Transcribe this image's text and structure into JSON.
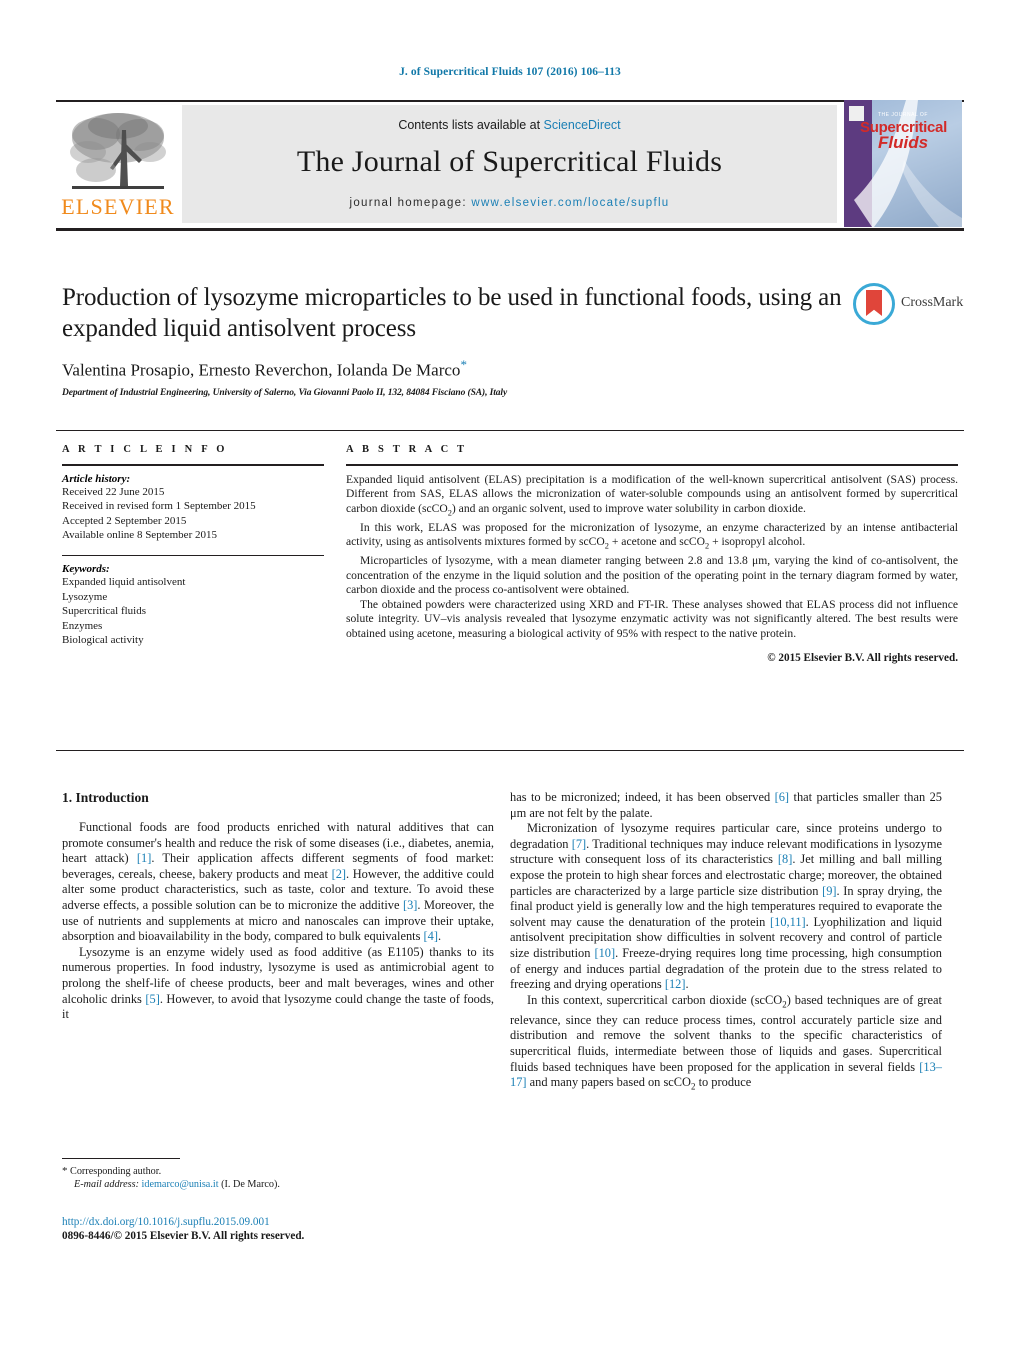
{
  "running_head": "J. of Supercritical Fluids 107 (2016) 106–113",
  "masthead": {
    "contents_prefix": "Contents lists available at ",
    "sciencedirect": "ScienceDirect",
    "journal_title": "The Journal of Supercritical Fluids",
    "homepage_prefix": "journal homepage: ",
    "homepage_url": "www.elsevier.com/locate/supflu",
    "publisher_logo": "ELSEVIER",
    "cover": {
      "line1": "THE JOURNAL OF",
      "line2": "Supercritical",
      "line3": "Fluids"
    }
  },
  "article": {
    "title": "Production of lysozyme microparticles to be used in functional foods, using an expanded liquid antisolvent process",
    "authors": "Valentina Prosapio, Ernesto Reverchon, Iolanda De Marco",
    "corresponding_marker": "*",
    "affiliation": "Department of Industrial Engineering, University of Salerno, Via Giovanni Paolo II, 132, 84084 Fisciano (SA), Italy",
    "crossmark_label": "CrossMark"
  },
  "article_info": {
    "heading": "A R T I C L E   I N F O",
    "history_label": "Article history:",
    "history": [
      "Received 22 June 2015",
      "Received in revised form 1 September 2015",
      "Accepted 2 September 2015",
      "Available online 8 September 2015"
    ],
    "keywords_label": "Keywords:",
    "keywords": [
      "Expanded liquid antisolvent",
      "Lysozyme",
      "Supercritical fluids",
      "Enzymes",
      "Biological activity"
    ]
  },
  "abstract": {
    "heading": "A B S T R A C T",
    "paragraphs": [
      "Expanded liquid antisolvent (ELAS) precipitation is a modification of the well-known supercritical antisolvent (SAS) process. Different from SAS, ELAS allows the micronization of water-soluble compounds using an antisolvent formed by supercritical carbon dioxide (scCO₂) and an organic solvent, used to improve water solubility in carbon dioxide.",
      "In this work, ELAS was proposed for the micronization of lysozyme, an enzyme characterized by an intense antibacterial activity, using as antisolvents mixtures formed by scCO₂ + acetone and scCO₂ + isopropyl alcohol.",
      "Microparticles of lysozyme, with a mean diameter ranging between 2.8 and 13.8 μm, varying the kind of co-antisolvent, the concentration of the enzyme in the liquid solution and the position of the operating point in the ternary diagram formed by water, carbon dioxide and the process co-antisolvent were obtained.",
      "The obtained powders were characterized using XRD and FT-IR. These analyses showed that ELAS process did not influence solute integrity. UV–vis analysis revealed that lysozyme enzymatic activity was not significantly altered. The best results were obtained using acetone, measuring a biological activity of 95% with respect to the native protein."
    ],
    "copyright": "© 2015 Elsevier B.V. All rights reserved."
  },
  "body": {
    "section_number_title": "1.  Introduction",
    "left_column": [
      "Functional foods are food products enriched with natural additives that can promote consumer's health and reduce the risk of some diseases (i.e., diabetes, anemia, heart attack) [1]. Their application affects different segments of food market: beverages, cereals, cheese, bakery products and meat [2]. However, the additive could alter some product characteristics, such as taste, color and texture. To avoid these adverse effects, a possible solution can be to micronize the additive [3]. Moreover, the use of nutrients and supplements at micro and nanoscales can improve their uptake, absorption and bioavailability in the body, compared to bulk equivalents [4].",
      "Lysozyme is an enzyme widely used as food additive (as E1105) thanks to its numerous properties. In food industry, lysozyme is used as antimicrobial agent to prolong the shelf-life of cheese products, beer and malt beverages, wines and other alcoholic drinks [5]. However, to avoid that lysozyme could change the taste of foods, it"
    ],
    "right_column": [
      "has to be micronized; indeed, it has been observed [6] that particles smaller than 25 μm are not felt by the palate.",
      "Micronization of lysozyme requires particular care, since proteins undergo to degradation [7]. Traditional techniques may induce relevant modifications in lysozyme structure with consequent loss of its characteristics [8]. Jet milling and ball milling expose the protein to high shear forces and electrostatic charge; moreover, the obtained particles are characterized by a large particle size distribution [9]. In spray drying, the final product yield is generally low and the high temperatures required to evaporate the solvent may cause the denaturation of the protein [10,11]. Lyophilization and liquid antisolvent precipitation show difficulties in solvent recovery and control of particle size distribution [10]. Freeze-drying requires long time processing, high consumption of energy and induces partial degradation of the protein due to the stress related to freezing and drying operations [12].",
      "In this context, supercritical carbon dioxide (scCO₂) based techniques are of great relevance, since they can reduce process times, control accurately particle size and distribution and remove the solvent thanks to the specific characteristics of supercritical fluids, intermediate between those of liquids and gases. Supercritical fluids based techniques have been proposed for the application in several fields [13–17] and many papers based on scCO₂ to produce"
    ]
  },
  "footnote": {
    "star": "*",
    "corresponding_author": "Corresponding author.",
    "email_label": "E-mail address:",
    "email": "idemarco@unisa.it",
    "email_suffix": "(I. De Marco)."
  },
  "footer": {
    "doi": "http://dx.doi.org/10.1016/j.supflu.2015.09.001",
    "issn_line": "0896-8446/© 2015 Elsevier B.V. All rights reserved."
  },
  "colors": {
    "link_blue": "#1a7fb5",
    "running_head_blue": "#1178a8",
    "elsevier_orange": "#f08a1c",
    "crossmark_red": "#e0453a",
    "crossmark_blue": "#3aa9d6",
    "band_gray": "#e8e8e8"
  }
}
